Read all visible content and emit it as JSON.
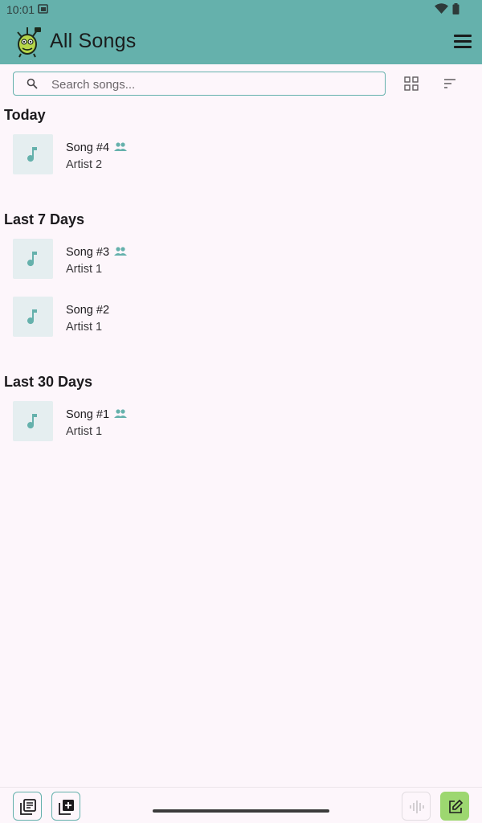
{
  "status_bar": {
    "time": "10:01"
  },
  "header": {
    "title": "All Songs"
  },
  "search": {
    "placeholder": "Search songs..."
  },
  "sections": [
    {
      "heading": "Today",
      "songs": [
        {
          "title": "Song #4",
          "artist": "Artist 2",
          "shared": true
        }
      ]
    },
    {
      "heading": "Last 7 Days",
      "songs": [
        {
          "title": "Song #3",
          "artist": "Artist 1",
          "shared": true
        },
        {
          "title": "Song #2",
          "artist": "Artist 1",
          "shared": false
        }
      ]
    },
    {
      "heading": "Last 30 Days",
      "songs": [
        {
          "title": "Song #1",
          "artist": "Artist 1",
          "shared": true
        }
      ]
    }
  ],
  "icons": {
    "logo": "app-logo-icon",
    "menu": "hamburger-menu-icon",
    "search": "search-icon",
    "grid": "grid-view-icon",
    "sort": "sort-icon",
    "song": "music-note-icon",
    "shared": "people-icon",
    "library": "library-icon",
    "add": "add-box-icon",
    "waveform": "waveform-icon",
    "edit": "edit-icon"
  },
  "colors": {
    "accent": "#65b1ac",
    "background": "#fdf6fb",
    "thumb_bg": "#e5eef0",
    "edit_button": "#9dd770"
  }
}
